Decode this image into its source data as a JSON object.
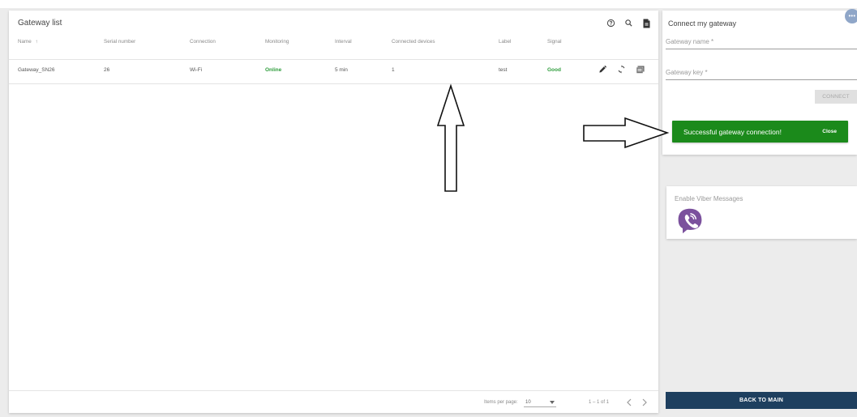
{
  "gateway_list": {
    "title": "Gateway list",
    "tool_icons": [
      "help-circle-icon",
      "search-icon",
      "file-download-icon"
    ],
    "columns": {
      "name": "Name",
      "name_sort": "↑",
      "serial": "Serial number",
      "connection": "Connection",
      "monitoring": "Monitoring",
      "interval": "Interval",
      "connected_devices": "Connected devices",
      "label": "Label",
      "signal": "Signal"
    },
    "rows": [
      {
        "name": "Gateway_SN26",
        "serial": "26",
        "connection": "Wi-Fi",
        "monitoring": "Online",
        "interval": "5 min",
        "connected_devices": "1",
        "label": "test",
        "signal": "Good"
      }
    ],
    "row_action_icons": [
      "edit-icon",
      "refresh-icon",
      "history-icon"
    ],
    "status_color": "#2e9d3c",
    "paginator": {
      "items_per_page_label": "Items per page:",
      "page_size": "10",
      "range": "1 – 1 of 1",
      "prev_icon": "chevron-left-icon",
      "next_icon": "chevron-right-icon"
    }
  },
  "connect_gateway": {
    "title": "Connect my gateway",
    "name_label": "Gateway name *",
    "key_label": "Gateway key *",
    "connect_button": "CONNECT"
  },
  "toast": {
    "message": "Successful gateway connection!",
    "close_label": "Close",
    "color": "#1b8a1b"
  },
  "more_button": "•••",
  "viber": {
    "title": "Enable Viber Messages",
    "logo_icon": "viber-logo-icon",
    "brand_color": "#7b519d"
  },
  "back_button": "BACK TO MAIN",
  "back_button_color": "#1e3f5f"
}
